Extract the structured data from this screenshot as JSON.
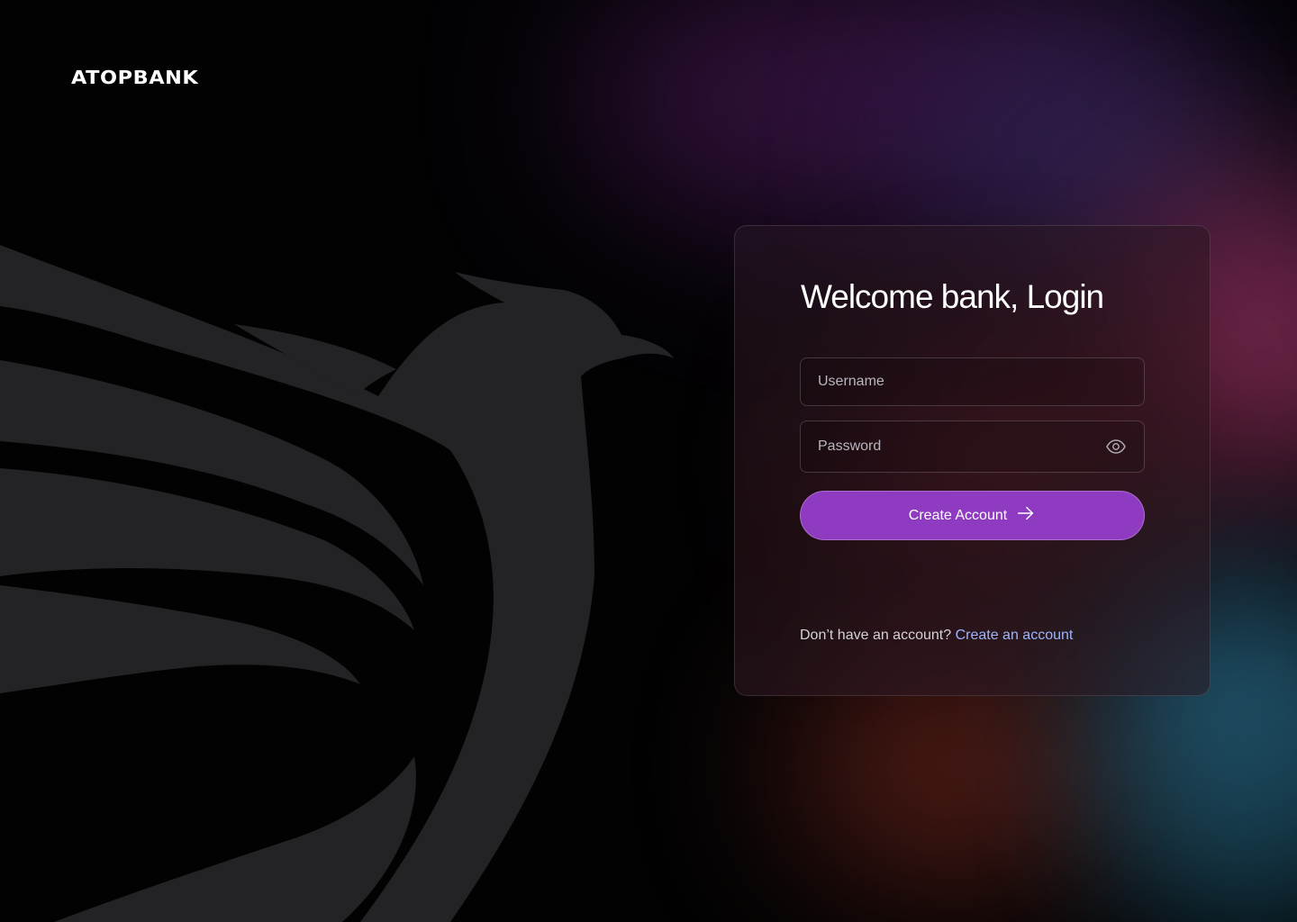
{
  "brand": {
    "name": "ATOPBANK"
  },
  "login": {
    "title": "Welcome bank, Login",
    "username_placeholder": "Username",
    "password_placeholder": "Password",
    "submit_label": "Create Account",
    "footer_prompt": "Don’t have an account?",
    "footer_link": "Create an account"
  },
  "icons": {
    "password_toggle": "eye-icon",
    "submit_arrow": "arrow-right-icon",
    "background_mark": "phoenix-logo"
  },
  "colors": {
    "primary_button": "#8f3bc1",
    "link": "#9cb6ff",
    "background": "#020203"
  }
}
